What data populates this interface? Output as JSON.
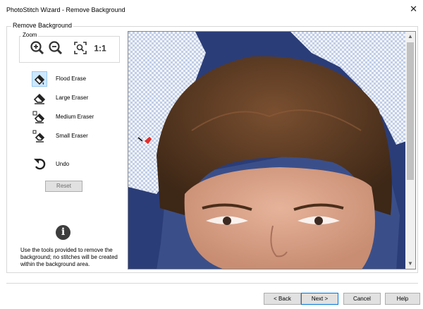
{
  "window": {
    "title": "PhotoStitch Wizard - Remove Background",
    "close_glyph": "✕"
  },
  "group": {
    "label": "Remove Background"
  },
  "zoom": {
    "label": "Zoom",
    "buttons": [
      {
        "icon": "zoom-in-icon"
      },
      {
        "icon": "zoom-out-icon"
      },
      {
        "icon": "zoom-fit-icon"
      },
      {
        "icon": "zoom-actual-size-icon",
        "text": "1:1"
      }
    ]
  },
  "tools": [
    {
      "label": "Flood Erase",
      "icon": "flood-erase-icon",
      "active": true
    },
    {
      "label": "Large Eraser",
      "icon": "large-eraser-icon",
      "active": false
    },
    {
      "label": "Medium Eraser",
      "icon": "medium-eraser-icon",
      "active": false
    },
    {
      "label": "Small Eraser",
      "icon": "small-eraser-icon",
      "active": false
    },
    {
      "label": "Undo",
      "icon": "undo-icon",
      "active": false
    }
  ],
  "reset_label": "Reset",
  "info": {
    "icon_glyph": "i",
    "text": "Use the tools provided to remove the background; no stitches will be created within the background area."
  },
  "footer": {
    "back": "< Back",
    "next": "Next >",
    "cancel": "Cancel",
    "help": "Help"
  },
  "colors": {
    "active_tool_bg": "#cde8ff",
    "photo_background": "#2b3d78",
    "hair": "#5a3a22",
    "skin": "#d9a48a"
  }
}
